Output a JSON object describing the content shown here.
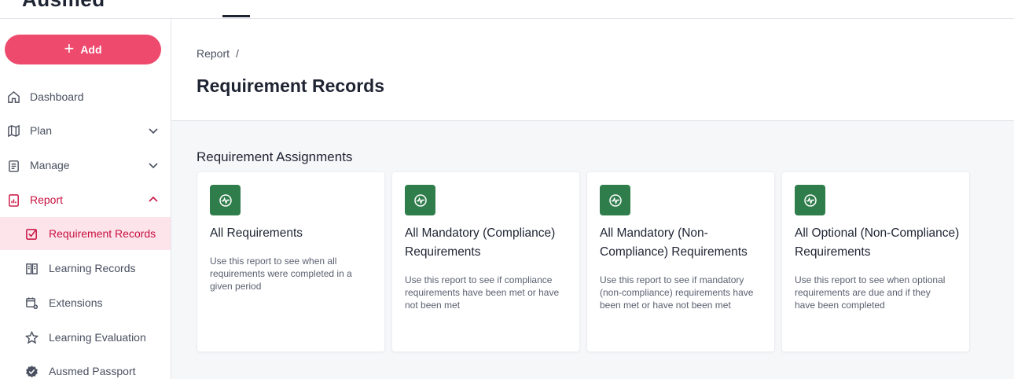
{
  "app": {
    "logo_text": "Ausmed"
  },
  "sidebar": {
    "add_label": "Add",
    "items": [
      {
        "label": "Dashboard"
      },
      {
        "label": "Plan"
      },
      {
        "label": "Manage"
      },
      {
        "label": "Report"
      }
    ],
    "report_children": [
      {
        "label": "Requirement Records"
      },
      {
        "label": "Learning Records"
      },
      {
        "label": "Extensions"
      },
      {
        "label": "Learning Evaluation"
      },
      {
        "label": "Ausmed Passport"
      }
    ]
  },
  "header": {
    "breadcrumb": "Report",
    "breadcrumb_sep": "/",
    "title": "Requirement Records"
  },
  "section": {
    "title": "Requirement Assignments",
    "cards": [
      {
        "title": "All Requirements",
        "description": "Use this report to see when all requirements were completed in a given period"
      },
      {
        "title": "All Mandatory (Compliance) Requirements",
        "description": "Use this report to see if compliance requirements have been met or have not been met"
      },
      {
        "title": "All Mandatory (Non-Compliance) Requirements",
        "description": "Use this report to see if mandatory (non-compliance) requirements have been met or have not been met"
      },
      {
        "title": "All Optional (Non-Compliance) Requirements",
        "description": "Use this report to see when optional requirements are due and if they have been completed"
      }
    ]
  },
  "colors": {
    "accent": "#ee4a6d",
    "active_text": "#c8103f",
    "active_bg": "#fde3ea",
    "card_icon_bg": "#2e7d4a"
  }
}
